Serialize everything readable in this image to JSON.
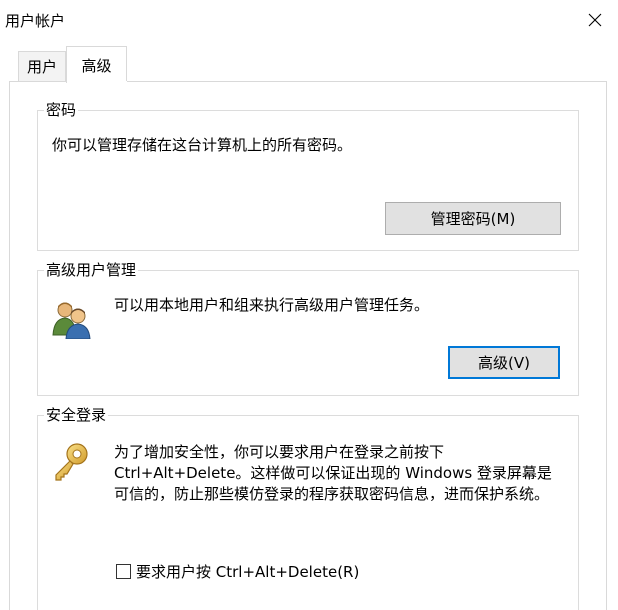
{
  "window": {
    "title": "用户帐户",
    "close_glyph": "✕"
  },
  "tabs": [
    {
      "label": "用户",
      "selected": false
    },
    {
      "label": "高级",
      "selected": true
    }
  ],
  "password_group": {
    "legend": "密码",
    "description": "你可以管理存储在这台计算机上的所有密码。",
    "button_label": "管理密码(M)"
  },
  "advanced_users_group": {
    "legend": "高级用户管理",
    "icon": "users-group-icon",
    "description": "可以用本地用户和组来执行高级用户管理任务。",
    "button_label": "高级(V)"
  },
  "secure_logon_group": {
    "legend": "安全登录",
    "icon": "key-icon",
    "description_lines": [
      "为了增加安全性，你可以要求用户在登录之前按下",
      "Ctrl+Alt+Delete。这样做可以保证出现的 Windows 登录屏幕是",
      "可信的，防止那些模仿登录的程序获取密码信息，进而保护系统。"
    ],
    "checkbox_label": "要求用户按 Ctrl+Alt+Delete(R)",
    "checkbox_checked": false
  },
  "colors": {
    "focus_border": "#0078d7",
    "button_face": "#e1e1e1",
    "group_border": "#dcdcdc"
  }
}
